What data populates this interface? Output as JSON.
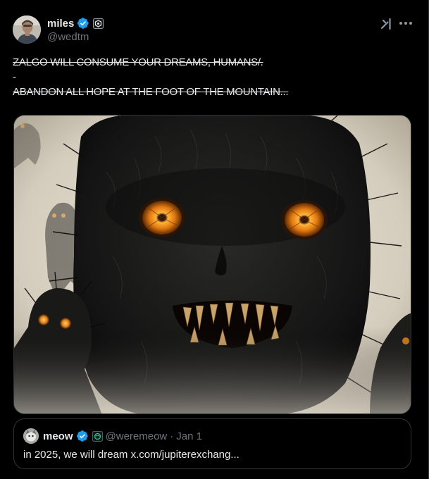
{
  "post": {
    "author": {
      "display_name": "miles",
      "handle": "@wedtm",
      "verified_badge": "verified-badge-icon",
      "affiliate_badge": "affiliate-badge-icon"
    },
    "text_lines": [
      "ZALGO WILL CONSUME YOUR DREAMS, HUMANS/.",
      "-",
      "ABANDON ALL HOPE AT THE FOOT OF THE MOUNTAIN..."
    ],
    "media": {
      "icon": "monster-image"
    },
    "actions": {
      "grok_icon": "grok-icon",
      "more_icon": "more-icon"
    }
  },
  "quote": {
    "display_name": "meow",
    "handle": "@weremeow",
    "separator": "·",
    "date": "Jan 1",
    "text": "in 2025, we will dream x.com/jupiterexchang..."
  },
  "colors": {
    "background": "#000000",
    "text": "#e7e9ea",
    "muted": "#71767b",
    "border": "#2f3336",
    "verified": "#1d9bf0"
  }
}
